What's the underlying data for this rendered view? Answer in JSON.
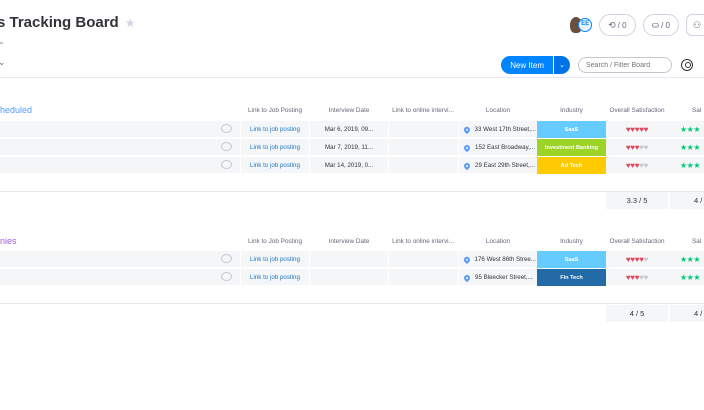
{
  "board": {
    "title": "s Tracking Board",
    "star": "★"
  },
  "header": {
    "avatar_badge": "EE",
    "updates_count": "/ 0",
    "activity_count": "/ 0",
    "new_item_label": "New Item",
    "new_item_arrow": "⌄",
    "search_placeholder": "Search / Filter Board"
  },
  "columns": [
    "Link to Job Posting",
    "Interview Date",
    "Link to online intervi...",
    "Location",
    "Industry",
    "Overall Satisfaction",
    "Sal"
  ],
  "groups": [
    {
      "title": "heduled",
      "color": "#579bfc",
      "rows": [
        {
          "link": "Link to job posting",
          "date": "Mar 6, 2019, 09...",
          "location": "33 West 17th Street,...",
          "industry": "SaaS",
          "industry_color": "#66ccff",
          "hearts": 5,
          "stars": "★★★"
        },
        {
          "link": "Link to job posting",
          "date": "Mar 7, 2019, 11...",
          "location": "152 East Broadway,...",
          "industry": "Investment Banking",
          "industry_color": "#9cd326",
          "hearts": 3,
          "stars": "★★★"
        },
        {
          "link": "Link to job posting",
          "date": "Mar 14, 2019, 0...",
          "location": "29 East 29th Street,...",
          "industry": "Ad Tech",
          "industry_color": "#ffcb00",
          "hearts": 3,
          "stars": "★★★"
        }
      ],
      "summary": "3.3 / 5",
      "summary2": "4 /"
    },
    {
      "title": "nies",
      "color": "#a25ddc",
      "rows": [
        {
          "link": "Link to job posting",
          "date": "",
          "location": "176 West 86th Stree...",
          "industry": "SaaS",
          "industry_color": "#66ccff",
          "hearts": 4,
          "stars": "★★★"
        },
        {
          "link": "Link to job posting",
          "date": "",
          "location": "95 Bleecker Street,...",
          "industry": "Fin Tech",
          "industry_color": "#226ba6",
          "hearts": 3,
          "stars": "★★★"
        }
      ],
      "summary": "4 / 5",
      "summary2": "4 /"
    }
  ]
}
